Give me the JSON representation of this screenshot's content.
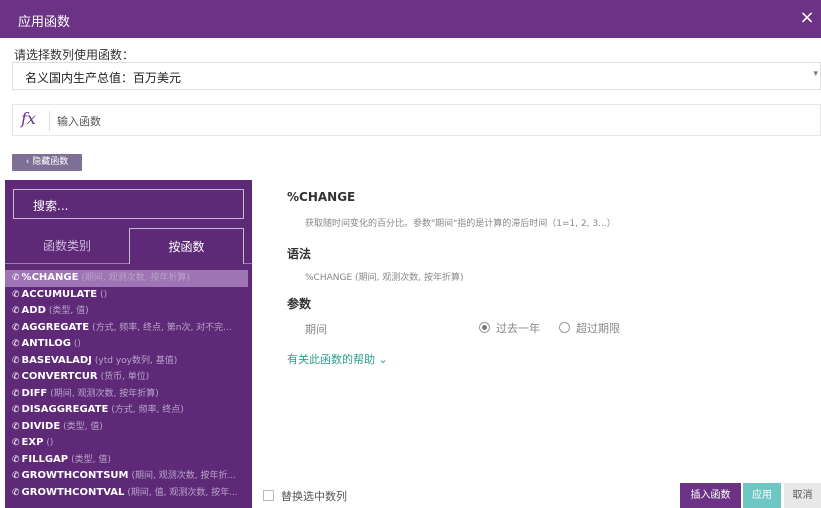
{
  "dialog": {
    "title": "应用函数",
    "close_icon": "×"
  },
  "series": {
    "label": "请选择数列使用函数：",
    "selected": "名义国内生产总值：百万美元",
    "caret": "▾"
  },
  "formula": {
    "fx": "fx",
    "placeholder": "输入函数"
  },
  "hide_button": "‹ 隐藏函数",
  "sidebar": {
    "search_placeholder": "搜索...",
    "tabs": [
      "函数类别",
      "按函数"
    ],
    "icon": "tag-icon",
    "functions": [
      {
        "name": "%CHANGE",
        "params": "(期间, 观测次数, 按年折算)",
        "selected": true
      },
      {
        "name": "ACCUMULATE",
        "params": "()"
      },
      {
        "name": "ADD",
        "params": "(类型, 值)"
      },
      {
        "name": "AGGREGATE",
        "params": "(方式, 频率, 终点, 第n次, 对不完..."
      },
      {
        "name": "ANTILOG",
        "params": "()"
      },
      {
        "name": "BASEVALADJ",
        "params": "(ytd yoy数列, 基值)"
      },
      {
        "name": "CONVERTCUR",
        "params": "(货币, 单位)"
      },
      {
        "name": "DIFF",
        "params": "(期间, 观测次数, 按年折算)"
      },
      {
        "name": "DISAGGREGATE",
        "params": "(方式, 频率, 终点)"
      },
      {
        "name": "DIVIDE",
        "params": "(类型, 值)"
      },
      {
        "name": "EXP",
        "params": "()"
      },
      {
        "name": "FILLGAP",
        "params": "(类型, 值)"
      },
      {
        "name": "GROWTHCONTSUM",
        "params": "(期间, 观测次数, 按年折..."
      },
      {
        "name": "GROWTHCONTVAL",
        "params": "(期间, 值, 观测次数, 按年..."
      }
    ]
  },
  "detail": {
    "title": "%CHANGE",
    "description": "获取随时间变化的百分比。参数\"期间\"指的是计算的滞后时间（1=1, 2, 3...）",
    "syntax_heading": "语法",
    "syntax": "%CHANGE (期间, 观测次数, 按年折算)",
    "params_heading": "参数",
    "param_name": "期间",
    "options": [
      "过去一年",
      "超过期限"
    ],
    "selected_option": 0,
    "help_link": "有关此函数的帮助 ⌄"
  },
  "footer": {
    "replace_label": "替换选中数列",
    "insert": "插入函数",
    "apply": "应用",
    "cancel": "取消"
  }
}
